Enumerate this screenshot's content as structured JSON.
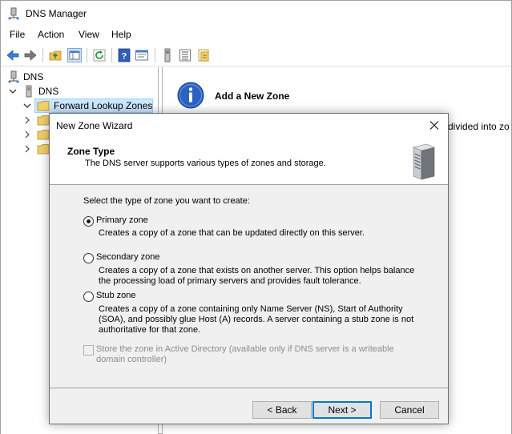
{
  "window": {
    "title": "DNS Manager"
  },
  "menu": [
    "File",
    "Action",
    "View",
    "Help"
  ],
  "toolbar": {
    "buttons": [
      "back-icon",
      "forward-icon",
      "up-folder-icon",
      "show-hide-tree-icon",
      "refresh-icon",
      "help-icon",
      "properties-icon",
      "server-icon",
      "list-icon",
      "folder-list-icon"
    ]
  },
  "tree": {
    "root": "DNS",
    "server": "DNS",
    "selected": "Forward Lookup Zones"
  },
  "right_pane": {
    "title": "Add a New Zone",
    "text_fragment": "divided into zo"
  },
  "wizard": {
    "title": "New Zone Wizard",
    "header_title": "Zone Type",
    "header_subtitle": "The DNS server supports various types of zones and storage.",
    "prompt": "Select the type of zone you want to create:",
    "options": [
      {
        "label": "Primary zone",
        "description": "Creates a copy of a zone that can be updated directly on this server.",
        "checked": true
      },
      {
        "label": "Secondary zone",
        "description": "Creates a copy of a zone that exists on another server. This option helps balance the processing load of primary servers and provides fault tolerance.",
        "checked": false
      },
      {
        "label": "Stub zone",
        "description": "Creates a copy of a zone containing only Name Server (NS), Start of Authority (SOA), and possibly glue Host (A) records. A server containing a stub zone is not authoritative for that zone.",
        "checked": false
      }
    ],
    "ad_checkbox": {
      "label": "Store the zone in Active Directory (available only if DNS server is a writeable domain controller)",
      "checked": false,
      "enabled": false
    },
    "buttons": {
      "back": "< Back",
      "next": "Next >",
      "cancel": "Cancel"
    }
  },
  "colors": {
    "selection": "#cce8ff",
    "accent": "#0078d7"
  }
}
